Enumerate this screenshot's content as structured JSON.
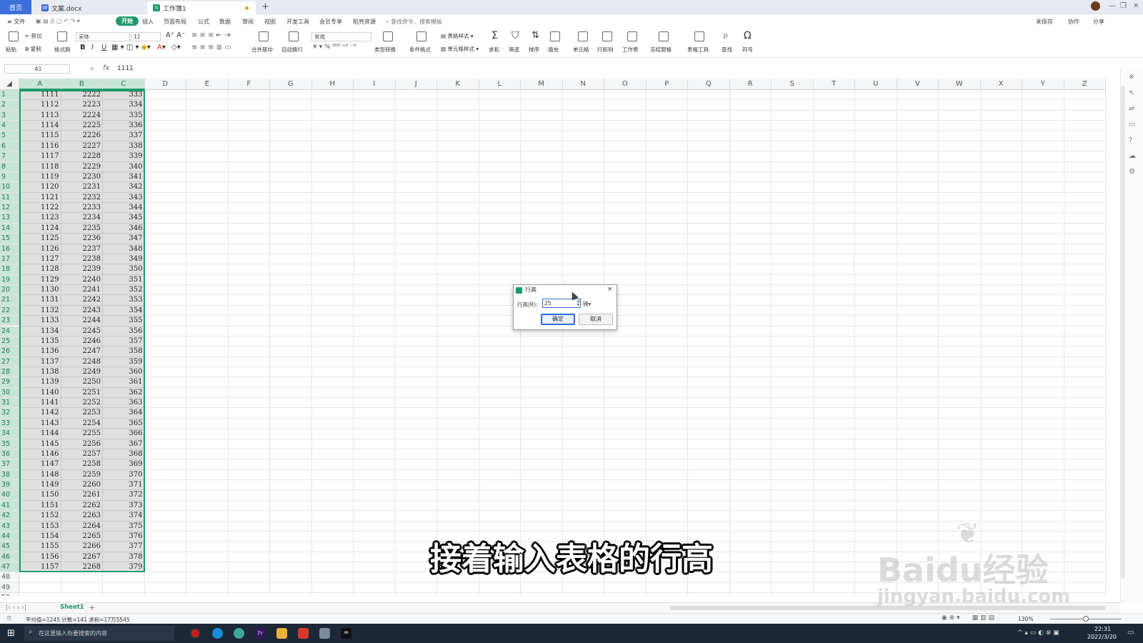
{
  "titlebar": {
    "home_tab": "首页",
    "doc_tab": "文案.docx",
    "sheet_tab": "工作簿1",
    "new_tab": "+"
  },
  "menubar": {
    "file": "文件",
    "items": [
      "开始",
      "插入",
      "页面布局",
      "公式",
      "数据",
      "审阅",
      "视图",
      "开发工具",
      "会员专享",
      "稻壳资源"
    ],
    "active": "开始",
    "search": "查找命令、搜索模板",
    "right": [
      "未保存",
      "协作",
      "分享"
    ]
  },
  "ribbon": {
    "paste": "粘贴",
    "cut": "剪切",
    "copy": "复制",
    "format_painter": "格式刷",
    "font_name": "宋体",
    "font_size": "11",
    "merge": "合并居中",
    "wrap": "自动换行",
    "number_format": "常规",
    "type_convert": "类型转换",
    "cond_format": "条件格式",
    "table_style": "表格样式",
    "cell_style": "单元格样式",
    "sum": "求和",
    "filter": "筛选",
    "sort": "排序",
    "fill": "填充",
    "cell": "单元格",
    "row_col": "行和列",
    "worksheet": "工作表",
    "freeze": "冻结窗格",
    "table_tools": "表格工具",
    "find": "查找",
    "symbol": "符号"
  },
  "formula_bar": {
    "name_box": "A1",
    "fx": "fx",
    "value": "1111"
  },
  "columns": [
    "A",
    "B",
    "C",
    "D",
    "E",
    "F",
    "G",
    "H",
    "I",
    "J",
    "K",
    "L",
    "M",
    "N",
    "O",
    "P",
    "Q",
    "R",
    "S",
    "T",
    "U",
    "V",
    "W",
    "X",
    "Y",
    "Z"
  ],
  "rows": {
    "count": 50,
    "data_rows": 47,
    "col_a_start": 1111,
    "col_b_start": 2222,
    "col_c_start": 333
  },
  "dialog": {
    "title": "行高",
    "label": "行高(R):",
    "value": "25",
    "unit": "磅",
    "ok": "确定",
    "cancel": "取消",
    "close": "×"
  },
  "sheetbar": {
    "sheet_name": "Sheet1",
    "add": "+"
  },
  "statusbar": {
    "stats": "平均值=1245  计数=141  求和=17万5545",
    "zoom": "130%"
  },
  "taskbar": {
    "search_placeholder": "在这里输入你要搜索的内容",
    "time": "22:31",
    "date": "2022/3/20"
  },
  "subtitle": "接着输入表格的行高",
  "watermark": {
    "brand": "Bai",
    "brand2": "du",
    "cn": "经验",
    "url": "jingyan.baidu.com"
  },
  "colors": {
    "accent": "#1e9b6c",
    "home_tab": "#3d6fd8",
    "selection_border": "#1e9b6c"
  }
}
